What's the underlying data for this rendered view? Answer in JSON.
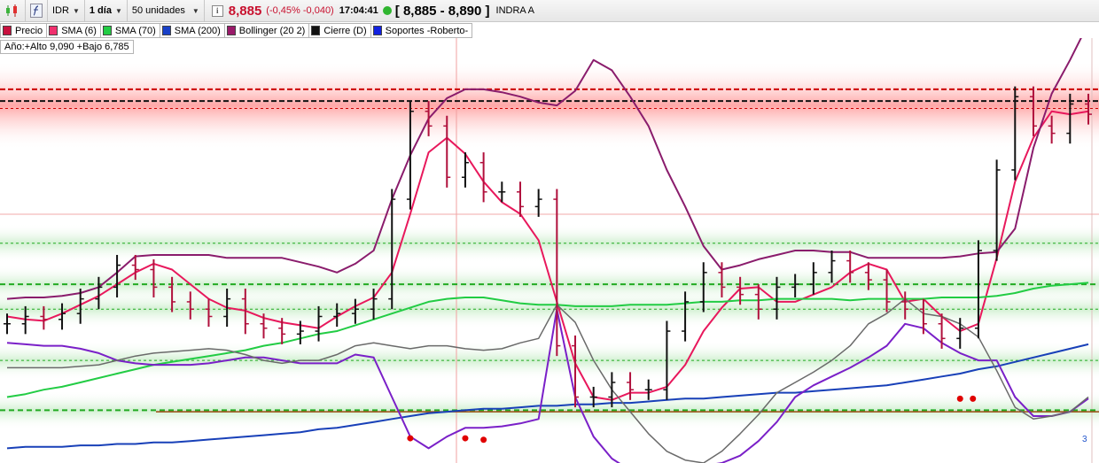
{
  "toolbar": {
    "ticker": "IDR",
    "interval": "1 día",
    "units": "50 unidades",
    "price": "8,885",
    "change": "(-0,45% -0,040)",
    "time": "17:04:41",
    "bid_ask": "[ 8,885 - 8,890 ]",
    "name": "INDRA A"
  },
  "legend": [
    {
      "label": "Precio",
      "color": "#c8103e"
    },
    {
      "label": "SMA (6)",
      "color": "#f0306e"
    },
    {
      "label": "SMA (70)",
      "color": "#22cc44"
    },
    {
      "label": "SMA (200)",
      "color": "#1840c8"
    },
    {
      "label": "Bollinger (20 2)",
      "color": "#9a1a6a"
    },
    {
      "label": "Cierre (D)",
      "color": "#111111"
    },
    {
      "label": "Soportes -Roberto-",
      "color": "#1020e0"
    }
  ],
  "year_range": "Año:+Alto 9,090 +Bajo 6,785",
  "page_number": "3",
  "colors": {
    "sma6": "#e8185c",
    "sma70": "#22cc44",
    "sma200": "#1840b8",
    "boll_upper": "#8a1c6c",
    "boll_lower": "#7a20c8",
    "cierre": "#6a6a6a",
    "bar_up": "#111111",
    "bar_down": "#b0103c",
    "resistance": "#cc0000",
    "support": "#22aa22",
    "signal_dots": "#e00000"
  },
  "chart_data": {
    "type": "line",
    "title": "",
    "xlabel": "",
    "ylabel": "",
    "ylim": [
      6.5,
      9.4
    ],
    "resistance_levels": [
      9.05,
      8.97,
      8.92
    ],
    "support_levels": [
      8.0,
      7.72,
      7.55,
      7.2,
      6.86
    ],
    "series": [
      {
        "name": "SMA (6)",
        "values": [
          7.5,
          7.48,
          7.47,
          7.52,
          7.58,
          7.64,
          7.72,
          7.8,
          7.86,
          7.82,
          7.72,
          7.62,
          7.56,
          7.54,
          7.49,
          7.46,
          7.44,
          7.42,
          7.5,
          7.57,
          7.63,
          7.8,
          8.2,
          8.62,
          8.72,
          8.61,
          8.42,
          8.28,
          8.2,
          8.02,
          7.6,
          7.18,
          6.95,
          6.93,
          6.98,
          6.98,
          7.02,
          7.17,
          7.4,
          7.56,
          7.69,
          7.7,
          7.6,
          7.6,
          7.65,
          7.7,
          7.8,
          7.86,
          7.82,
          7.6,
          7.62,
          7.5,
          7.4,
          7.45,
          7.9,
          8.42,
          8.72,
          8.9,
          8.88,
          8.9
        ]
      },
      {
        "name": "SMA (70)",
        "values": [
          6.95,
          6.97,
          7.0,
          7.02,
          7.05,
          7.08,
          7.11,
          7.14,
          7.17,
          7.19,
          7.21,
          7.23,
          7.25,
          7.27,
          7.3,
          7.32,
          7.35,
          7.38,
          7.4,
          7.44,
          7.48,
          7.52,
          7.56,
          7.6,
          7.62,
          7.63,
          7.63,
          7.61,
          7.59,
          7.58,
          7.58,
          7.57,
          7.57,
          7.57,
          7.58,
          7.58,
          7.58,
          7.59,
          7.6,
          7.6,
          7.61,
          7.61,
          7.62,
          7.62,
          7.62,
          7.62,
          7.61,
          7.62,
          7.62,
          7.62,
          7.62,
          7.63,
          7.63,
          7.63,
          7.64,
          7.66,
          7.69,
          7.71,
          7.72,
          7.73
        ]
      },
      {
        "name": "SMA (200)",
        "values": [
          6.6,
          6.61,
          6.61,
          6.61,
          6.62,
          6.62,
          6.63,
          6.63,
          6.64,
          6.64,
          6.65,
          6.66,
          6.67,
          6.68,
          6.69,
          6.7,
          6.71,
          6.73,
          6.74,
          6.76,
          6.78,
          6.8,
          6.82,
          6.84,
          6.85,
          6.86,
          6.87,
          6.87,
          6.88,
          6.89,
          6.89,
          6.9,
          6.9,
          6.91,
          6.91,
          6.92,
          6.93,
          6.94,
          6.94,
          6.95,
          6.96,
          6.97,
          6.98,
          6.98,
          6.99,
          7.0,
          7.01,
          7.02,
          7.03,
          7.05,
          7.07,
          7.09,
          7.11,
          7.14,
          7.16,
          7.19,
          7.22,
          7.25,
          7.28,
          7.31
        ]
      },
      {
        "name": "Bollinger upper",
        "values": [
          7.62,
          7.63,
          7.63,
          7.64,
          7.66,
          7.7,
          7.8,
          7.91,
          7.92,
          7.92,
          7.92,
          7.92,
          7.9,
          7.9,
          7.9,
          7.9,
          7.87,
          7.84,
          7.8,
          7.86,
          7.95,
          8.3,
          8.6,
          8.85,
          8.99,
          9.05,
          9.05,
          9.03,
          9.0,
          8.96,
          8.94,
          9.04,
          9.25,
          9.18,
          9.0,
          8.8,
          8.5,
          8.25,
          7.98,
          7.82,
          7.85,
          7.89,
          7.92,
          7.95,
          7.95,
          7.94,
          7.94,
          7.9,
          7.9,
          7.9,
          7.9,
          7.9,
          7.91,
          7.93,
          7.94,
          8.1,
          8.65,
          9.02,
          9.25,
          9.5
        ]
      },
      {
        "name": "Bollinger lower",
        "values": [
          7.32,
          7.31,
          7.3,
          7.3,
          7.28,
          7.25,
          7.2,
          7.18,
          7.17,
          7.17,
          7.17,
          7.18,
          7.2,
          7.22,
          7.22,
          7.2,
          7.18,
          7.18,
          7.18,
          7.24,
          7.22,
          6.95,
          6.68,
          6.6,
          6.68,
          6.74,
          6.74,
          6.75,
          6.77,
          6.8,
          7.55,
          6.95,
          6.68,
          6.53,
          6.45,
          6.4,
          6.45,
          6.48,
          6.48,
          6.5,
          6.55,
          6.65,
          6.78,
          6.95,
          7.03,
          7.09,
          7.15,
          7.22,
          7.3,
          7.45,
          7.42,
          7.32,
          7.25,
          7.2,
          7.2,
          6.95,
          6.82,
          6.82,
          6.85,
          6.94
        ]
      },
      {
        "name": "Cierre (D)",
        "values": [
          7.15,
          7.15,
          7.15,
          7.15,
          7.16,
          7.17,
          7.2,
          7.23,
          7.25,
          7.26,
          7.27,
          7.28,
          7.27,
          7.24,
          7.2,
          7.18,
          7.2,
          7.2,
          7.24,
          7.3,
          7.32,
          7.3,
          7.28,
          7.3,
          7.3,
          7.28,
          7.27,
          7.28,
          7.32,
          7.35,
          7.58,
          7.46,
          7.2,
          7.0,
          6.85,
          6.7,
          6.58,
          6.52,
          6.5,
          6.58,
          6.7,
          6.83,
          6.98,
          7.05,
          7.12,
          7.2,
          7.3,
          7.45,
          7.52,
          7.62,
          7.52,
          7.5,
          7.45,
          7.36,
          7.13,
          6.88,
          6.8,
          6.82,
          6.85,
          6.95
        ]
      },
      {
        "name": "Precio",
        "values": [
          7.45,
          7.5,
          7.48,
          7.52,
          7.62,
          7.7,
          7.85,
          7.82,
          7.7,
          7.6,
          7.55,
          7.5,
          7.62,
          7.45,
          7.42,
          7.38,
          7.4,
          7.5,
          7.52,
          7.55,
          7.62,
          8.3,
          8.9,
          8.8,
          8.45,
          8.55,
          8.35,
          8.35,
          8.25,
          8.3,
          7.3,
          6.95,
          6.95,
          7.05,
          7.0,
          7.0,
          7.4,
          7.6,
          7.8,
          7.7,
          7.65,
          7.55,
          7.7,
          7.72,
          7.8,
          7.88,
          7.8,
          7.75,
          7.6,
          7.55,
          7.45,
          7.35,
          7.42,
          7.95,
          8.5,
          9.0,
          8.8,
          8.75,
          8.95,
          8.88
        ]
      }
    ],
    "signals": [
      {
        "x": 22,
        "y": 6.85
      },
      {
        "x": 25,
        "y": 6.85
      },
      {
        "x": 26,
        "y": 6.84
      },
      {
        "x": 52,
        "y": 7.12
      },
      {
        "x": 52.7,
        "y": 7.12
      }
    ]
  }
}
